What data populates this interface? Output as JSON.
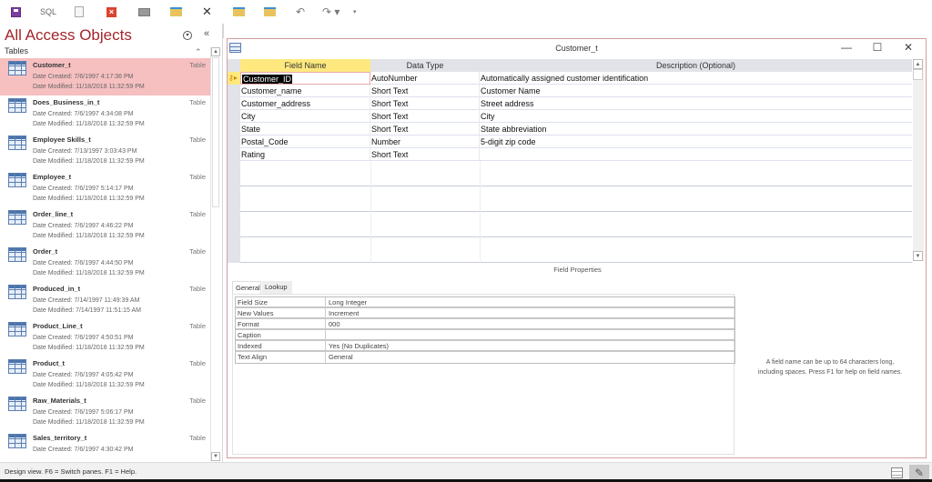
{
  "quick_access_toolbar": {
    "items": [
      {
        "name": "save",
        "icon": "save-icon"
      },
      {
        "name": "sql",
        "label": "SQL",
        "icon": "sql-icon"
      },
      {
        "name": "document",
        "icon": "document-icon"
      },
      {
        "name": "close-object",
        "icon": "red-close-icon"
      },
      {
        "name": "window",
        "icon": "window-icon"
      },
      {
        "name": "new-folder",
        "icon": "folder-icon"
      },
      {
        "name": "delete",
        "icon": "x-icon",
        "glyph": "✕"
      },
      {
        "name": "folder-2",
        "icon": "folder-icon"
      },
      {
        "name": "folder-3",
        "icon": "folder-icon"
      },
      {
        "name": "undo",
        "icon": "undo-icon",
        "glyph": "↶"
      },
      {
        "name": "redo",
        "icon": "redo-icon",
        "glyph": "↷ ▾"
      },
      {
        "name": "customize",
        "icon": "customize-icon",
        "glyph": "▾"
      }
    ]
  },
  "nav_pane": {
    "title": "All Access Objects",
    "menu_glyph": "▾",
    "collapse_glyph": "«",
    "group_label": "Tables",
    "group_collapse_glyph": "⌃",
    "items": [
      {
        "name": "Customer_t",
        "type": "Table",
        "created": "Date Created: 7/6/1997 4:17:36 PM",
        "modified": "Date Modified: 11/18/2018 11:32:59 PM",
        "selected": true
      },
      {
        "name": "Does_Business_in_t",
        "type": "Table",
        "created": "Date Created: 7/6/1997 4:34:08 PM",
        "modified": "Date Modified: 11/18/2018 11:32:59 PM"
      },
      {
        "name": "Employee Skills_t",
        "type": "Table",
        "created": "Date Created: 7/13/1997 3:03:43 PM",
        "modified": "Date Modified: 11/18/2018 11:32:59 PM"
      },
      {
        "name": "Employee_t",
        "type": "Table",
        "created": "Date Created: 7/6/1997 5:14:17 PM",
        "modified": "Date Modified: 11/18/2018 11:32:59 PM"
      },
      {
        "name": "Order_line_t",
        "type": "Table",
        "created": "Date Created: 7/6/1997 4:46:22 PM",
        "modified": "Date Modified: 11/18/2018 11:32:59 PM"
      },
      {
        "name": "Order_t",
        "type": "Table",
        "created": "Date Created: 7/6/1997 4:44:50 PM",
        "modified": "Date Modified: 11/18/2018 11:32:59 PM"
      },
      {
        "name": "Produced_in_t",
        "type": "Table",
        "created": "Date Created: 7/14/1997 11:49:39 AM",
        "modified": "Date Modified: 7/14/1997 11:51:15 AM"
      },
      {
        "name": "Product_Line_t",
        "type": "Table",
        "created": "Date Created: 7/6/1997 4:50:51 PM",
        "modified": "Date Modified: 11/18/2018 11:32:59 PM"
      },
      {
        "name": "Product_t",
        "type": "Table",
        "created": "Date Created: 7/6/1997 4:05:42 PM",
        "modified": "Date Modified: 11/18/2018 11:32:59 PM"
      },
      {
        "name": "Raw_Materials_t",
        "type": "Table",
        "created": "Date Created: 7/6/1997 5:06:17 PM",
        "modified": "Date Modified: 11/18/2018 11:32:59 PM"
      },
      {
        "name": "Sales_territory_t",
        "type": "Table",
        "created": "Date Created: 7/6/1997 4:30:42 PM",
        "modified": ""
      }
    ]
  },
  "document": {
    "title": "Customer_t",
    "window_buttons": {
      "minimize": "—",
      "maximize": "☐",
      "close": "✕"
    },
    "grid": {
      "headers": {
        "field_name": "Field Name",
        "data_type": "Data Type",
        "description": "Description (Optional)"
      },
      "rows": [
        {
          "field": "Customer_ID",
          "type": "AutoNumber",
          "description": "Automatically assigned customer identification",
          "primary_key": true,
          "active": true
        },
        {
          "field": "Customer_name",
          "type": "Short Text",
          "description": "Customer Name"
        },
        {
          "field": "Customer_address",
          "type": "Short Text",
          "description": "Street address"
        },
        {
          "field": "City",
          "type": "Short Text",
          "description": "City"
        },
        {
          "field": "State",
          "type": "Short Text",
          "description": "State abbreviation"
        },
        {
          "field": "Postal_Code",
          "type": "Number",
          "description": "5-digit zip code"
        },
        {
          "field": "Rating",
          "type": "Short Text",
          "description": ""
        }
      ],
      "row_marker_glyph": "▸"
    },
    "field_properties": {
      "label": "Field Properties",
      "tabs": [
        "General",
        "Lookup"
      ],
      "active_tab": "General",
      "properties": [
        {
          "key": "Field Size",
          "value": "Long Integer"
        },
        {
          "key": "New Values",
          "value": "Increment"
        },
        {
          "key": "Format",
          "value": "000"
        },
        {
          "key": "Caption",
          "value": ""
        },
        {
          "key": "Indexed",
          "value": "Yes (No Duplicates)"
        },
        {
          "key": "Text Align",
          "value": "General"
        }
      ],
      "help_text_line1": "A field name can be up to 64 characters long,",
      "help_text_line2": "including spaces. Press F1 for help on field names."
    }
  },
  "status_bar": {
    "text": "Design view.  F6 = Switch panes.  F1 = Help.",
    "views": [
      {
        "name": "datasheet-view",
        "icon": "datasheet-view-icon",
        "active": false
      },
      {
        "name": "design-view",
        "icon": "design-view-icon",
        "glyph": "✎",
        "active": true
      }
    ]
  }
}
